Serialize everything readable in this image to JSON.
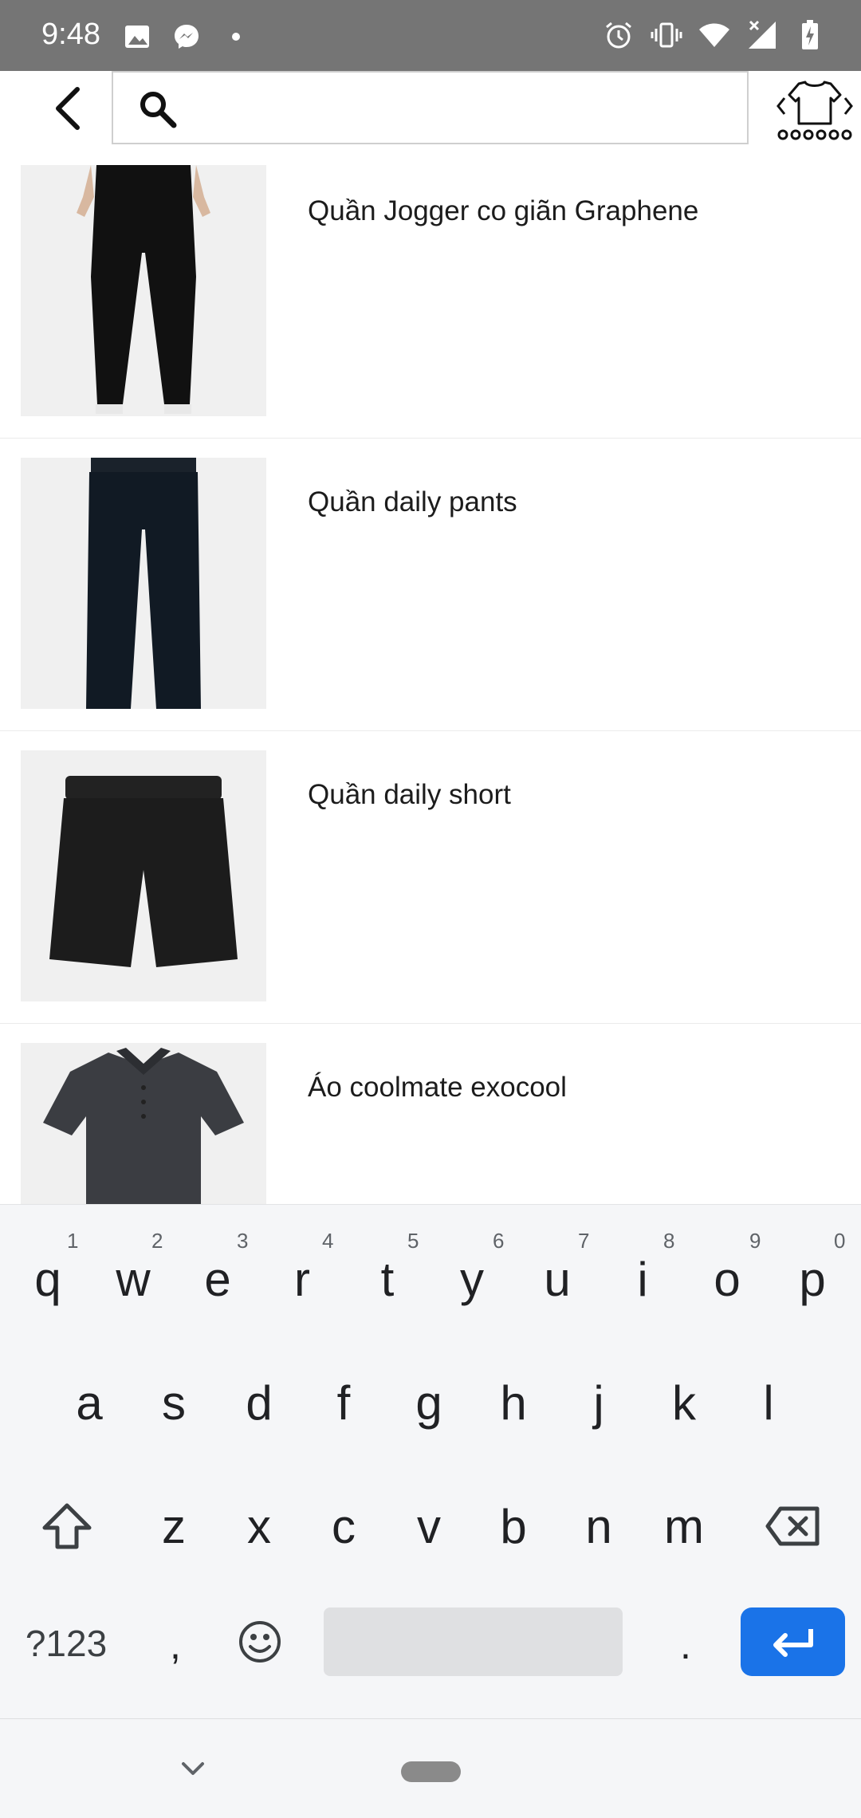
{
  "status_bar": {
    "time": "9:48",
    "left_icons": [
      "image-icon",
      "messenger-icon",
      "dot-icon"
    ],
    "right_icons": [
      "alarm-icon",
      "vibrate-icon",
      "wifi-icon",
      "signal-icon",
      "battery-charging-icon"
    ]
  },
  "header": {
    "search_placeholder": "",
    "search_value": ""
  },
  "products": [
    {
      "name": "Quần Jogger co giãn Graphene",
      "image": "black-jogger-pants"
    },
    {
      "name": "Quần daily pants",
      "image": "navy-pants"
    },
    {
      "name": "Quần daily short",
      "image": "black-shorts"
    },
    {
      "name": "Áo coolmate exocool",
      "image": "grey-polo-shirt"
    }
  ],
  "keyboard": {
    "row1": [
      "q",
      "w",
      "e",
      "r",
      "t",
      "y",
      "u",
      "i",
      "o",
      "p"
    ],
    "row1_hints": [
      "1",
      "2",
      "3",
      "4",
      "5",
      "6",
      "7",
      "8",
      "9",
      "0"
    ],
    "row2": [
      "a",
      "s",
      "d",
      "f",
      "g",
      "h",
      "j",
      "k",
      "l"
    ],
    "row3": [
      "z",
      "x",
      "c",
      "v",
      "b",
      "n",
      "m"
    ],
    "symbols_label": "?123",
    "comma": ",",
    "period": ".",
    "colors": {
      "enter": "#1a73e8",
      "background": "#f5f6f8"
    }
  }
}
